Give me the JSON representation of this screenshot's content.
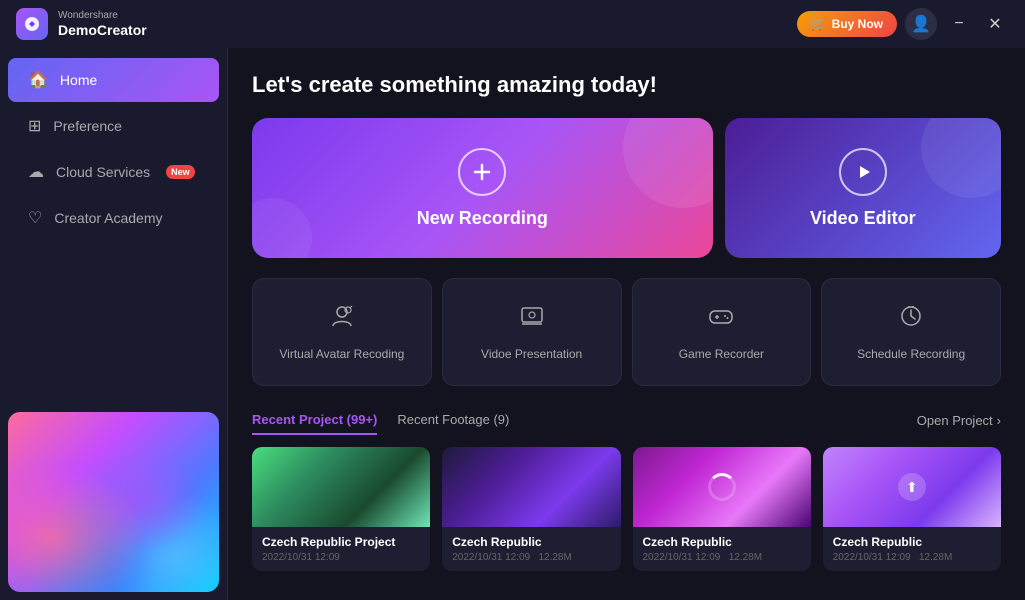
{
  "app": {
    "brand": "Wondershare",
    "name": "DemoCreator"
  },
  "titlebar": {
    "buy_label": "Buy Now",
    "minimize_icon": "−",
    "close_icon": "✕"
  },
  "sidebar": {
    "items": [
      {
        "id": "home",
        "label": "Home",
        "icon": "⌂",
        "active": true
      },
      {
        "id": "preference",
        "label": "Preference",
        "icon": "⚙"
      },
      {
        "id": "cloud-services",
        "label": "Cloud Services",
        "icon": "☁",
        "badge": "New"
      },
      {
        "id": "creator-academy",
        "label": "Creator Academy",
        "icon": "♡"
      }
    ]
  },
  "main": {
    "greeting": "Let's create something amazing today!",
    "hero_cards": [
      {
        "id": "new-recording",
        "label": "New Recording",
        "icon": "+"
      },
      {
        "id": "video-editor",
        "label": "Video Editor",
        "icon": "▶"
      }
    ],
    "feature_cards": [
      {
        "id": "virtual-avatar",
        "label": "Virtual Avatar Recoding",
        "icon": "👤"
      },
      {
        "id": "video-presentation",
        "label": "Vidoe Presentation",
        "icon": "🖼"
      },
      {
        "id": "game-recorder",
        "label": "Game Recorder",
        "icon": "🎮"
      },
      {
        "id": "schedule-recording",
        "label": "Schedule Recording",
        "icon": "⏱"
      }
    ],
    "recent_tabs": [
      {
        "id": "recent-project",
        "label": "Recent Project (99+)",
        "active": true
      },
      {
        "id": "recent-footage",
        "label": "Recent Footage (9)",
        "active": false
      }
    ],
    "open_project_label": "Open Project",
    "projects": [
      {
        "id": "project-1",
        "name": "Czech Republic Project",
        "date": "2022/10/31 12:09",
        "size": "",
        "thumb_type": "1"
      },
      {
        "id": "project-2",
        "name": "Czech Republic",
        "date": "2022/10/31 12:09",
        "size": "12.28M",
        "thumb_type": "2"
      },
      {
        "id": "project-3",
        "name": "Czech Republic",
        "date": "2022/10/31 12:09",
        "size": "12.28M",
        "thumb_type": "3"
      },
      {
        "id": "project-4",
        "name": "Czech Republic",
        "date": "2022/10/31 12:09",
        "size": "12.28M",
        "thumb_type": "4"
      }
    ]
  },
  "colors": {
    "accent": "#a855f7",
    "sidebar_bg": "#1a1a2e",
    "main_bg": "#13131f",
    "card_bg": "#1e1e32"
  }
}
